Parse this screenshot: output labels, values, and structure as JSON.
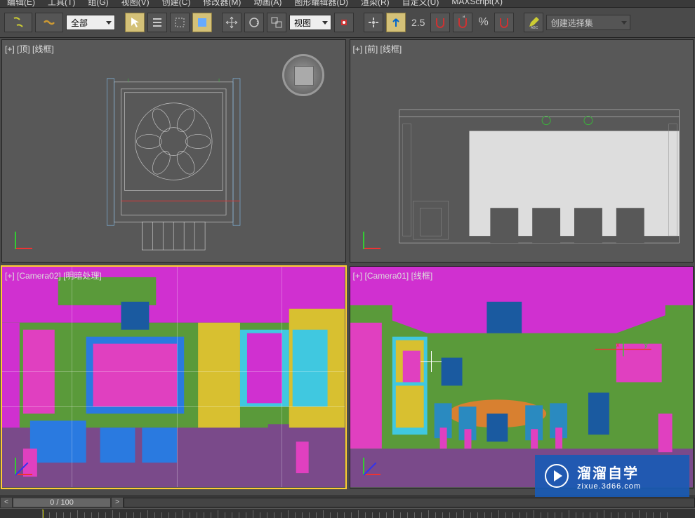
{
  "menubar": {
    "items": [
      "编辑(E)",
      "工具(T)",
      "组(G)",
      "视图(V)",
      "创建(C)",
      "修改器(M)",
      "动画(A)",
      "图形编辑器(D)",
      "渲染(R)",
      "自定义(U)",
      "MAXScript(X)"
    ]
  },
  "toolbar": {
    "selection_set_dropdown": "全部",
    "view_dropdown": "视图",
    "snap_value": "2.5",
    "named_selection_dropdown": "创建选择集"
  },
  "viewports": {
    "top_left": {
      "handle": "[+]",
      "name": "[顶]",
      "mode": "[线框]"
    },
    "top_right": {
      "handle": "[+]",
      "name": "[前]",
      "mode": "[线框]"
    },
    "bottom_left": {
      "handle": "[+]",
      "name": "[Camera02]",
      "mode": "[明暗处理]"
    },
    "bottom_right": {
      "handle": "[+]",
      "name": "[Camera01]",
      "mode": "[线框]"
    }
  },
  "timeline": {
    "frame_display": "0 / 100"
  },
  "watermark": {
    "title": "溜溜自学",
    "url": "zixue.3d66.com"
  }
}
